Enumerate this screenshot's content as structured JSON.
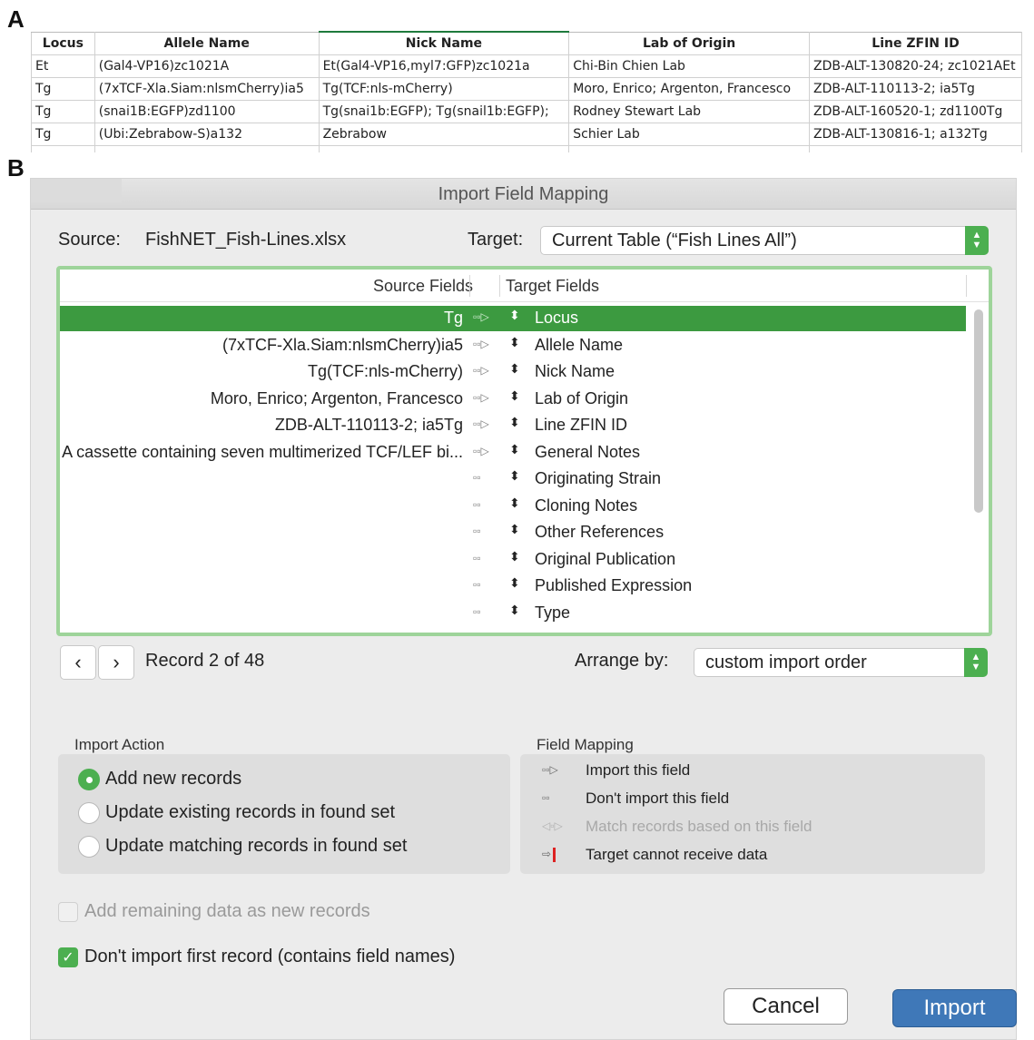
{
  "panel_labels": {
    "a": "A",
    "b": "B"
  },
  "spreadsheet": {
    "headers": [
      "Locus",
      "Allele Name",
      "Nick Name",
      "Lab of Origin",
      "Line ZFIN ID"
    ],
    "rows": [
      [
        "Et",
        "(Gal4-VP16)zc1021A",
        "Et(Gal4-VP16,myl7:GFP)zc1021a",
        "Chi-Bin Chien Lab",
        "ZDB-ALT-130820-24; zc1021AEt"
      ],
      [
        "Tg",
        "(7xTCF-Xla.Siam:nlsmCherry)ia5",
        "Tg(TCF:nls-mCherry)",
        "Moro, Enrico; Argenton, Francesco",
        "ZDB-ALT-110113-2; ia5Tg"
      ],
      [
        "Tg",
        "(snai1B:EGFP)zd1100",
        "Tg(snai1b:EGFP); Tg(snail1b:EGFP);",
        "Rodney Stewart Lab",
        "ZDB-ALT-160520-1; zd1100Tg"
      ],
      [
        "Tg",
        "(Ubi:Zebrabow-S)a132",
        "Zebrabow",
        "Schier Lab",
        "ZDB-ALT-130816-1; a132Tg"
      ]
    ]
  },
  "dialog": {
    "title": "Import Field Mapping",
    "source_label": "Source:",
    "source_file": "FishNET_Fish-Lines.xlsx",
    "target_label": "Target:",
    "target_value": "Current Table (“Fish Lines All”)",
    "columns": {
      "source": "Source Fields",
      "target": "Target Fields"
    },
    "mappings": [
      {
        "source": "Tg",
        "arrow": "▫▫▷",
        "target": "Locus"
      },
      {
        "source": "(7xTCF-Xla.Siam:nlsmCherry)ia5",
        "arrow": "▫▫▷",
        "target": "Allele Name"
      },
      {
        "source": "Tg(TCF:nls-mCherry)",
        "arrow": "▫▫▷",
        "target": "Nick Name"
      },
      {
        "source": "Moro, Enrico; Argenton, Francesco",
        "arrow": "▫▫▷",
        "target": "Lab of Origin"
      },
      {
        "source": "ZDB-ALT-110113-2; ia5Tg",
        "arrow": "▫▫▷",
        "target": "Line ZFIN ID"
      },
      {
        "source": "A cassette containing seven multimerized TCF/LEF bi...",
        "arrow": "▫▫▷",
        "target": "General Notes"
      },
      {
        "source": "",
        "arrow": "▫▫",
        "target": "Originating Strain"
      },
      {
        "source": "",
        "arrow": "▫▫",
        "target": "Cloning Notes"
      },
      {
        "source": "",
        "arrow": "▫▫",
        "target": "Other References"
      },
      {
        "source": "",
        "arrow": "▫▫",
        "target": "Original Publication"
      },
      {
        "source": "",
        "arrow": "▫▫",
        "target": "Published Expression"
      },
      {
        "source": "",
        "arrow": "▫▫",
        "target": "Type"
      }
    ],
    "updown_glyph": "⬍",
    "record_label": "Record 2 of 48",
    "arrange_label": "Arrange by:",
    "arrange_value": "custom import order",
    "import_action": {
      "title": "Import Action",
      "options": [
        "Add new records",
        "Update existing records in found set",
        "Update matching records in found set"
      ],
      "selected": 0
    },
    "field_mapping_legend": {
      "title": "Field Mapping",
      "items": [
        {
          "icon": "▫▫▷",
          "label": "Import this field"
        },
        {
          "icon": "▫▫",
          "label": "Don't import this field"
        },
        {
          "icon": "◁▫▷",
          "label": "Match records based on this field"
        },
        {
          "icon": "⇨",
          "label": "Target cannot receive data"
        }
      ]
    },
    "add_remaining": {
      "label": "Add remaining data as new records",
      "checked": false,
      "enabled": false
    },
    "skip_first": {
      "label": "Don't import first record (contains field names)",
      "checked": true,
      "enabled": true
    },
    "cancel_label": "Cancel",
    "import_label": "Import",
    "colors": {
      "accent_green": "#4caf50",
      "selected_row": "#3c9a40",
      "import_blue": "#3f78b8"
    }
  }
}
